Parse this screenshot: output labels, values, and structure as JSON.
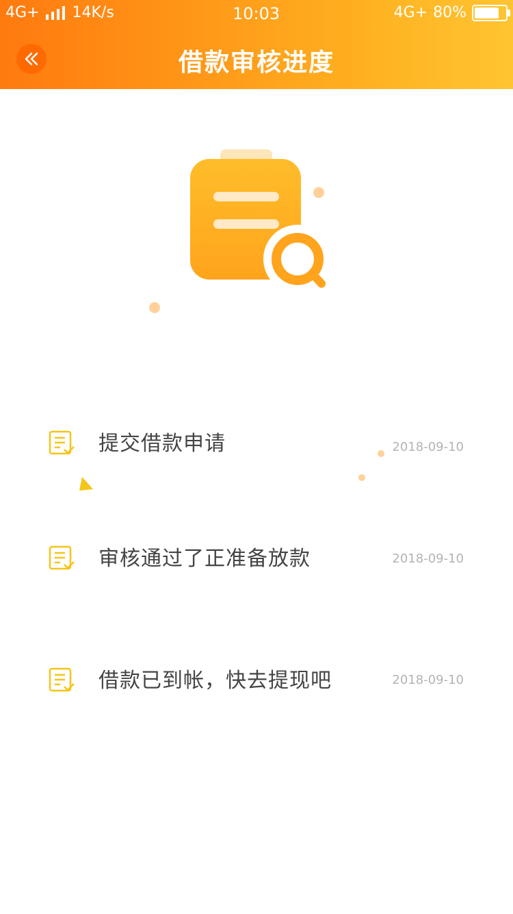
{
  "status_bar": {
    "network_left": "4G+",
    "speed": "14K/s",
    "time": "10:03",
    "network_right": "4G+",
    "battery": "80%",
    "battery_level": 0.8
  },
  "header": {
    "title": "借款审核进度",
    "back_icon": "double-chevron-left-icon"
  },
  "colors": {
    "gradient_start": "#ff7a0f",
    "gradient_end": "#ffc531",
    "back_button": "#ff6a00",
    "step_icon": "#f5c518",
    "label": "#444444",
    "date": "#b3b3b3"
  },
  "progress": {
    "steps": [
      {
        "label": "提交借款申请",
        "date": "2018-09-10",
        "icon": "document-check-icon"
      },
      {
        "label": "审核通过了正准备放款",
        "date": "2018-09-10",
        "icon": "document-check-icon"
      },
      {
        "label": "借款已到帐，快去提现吧",
        "date": "2018-09-10",
        "icon": "document-check-icon"
      }
    ]
  }
}
